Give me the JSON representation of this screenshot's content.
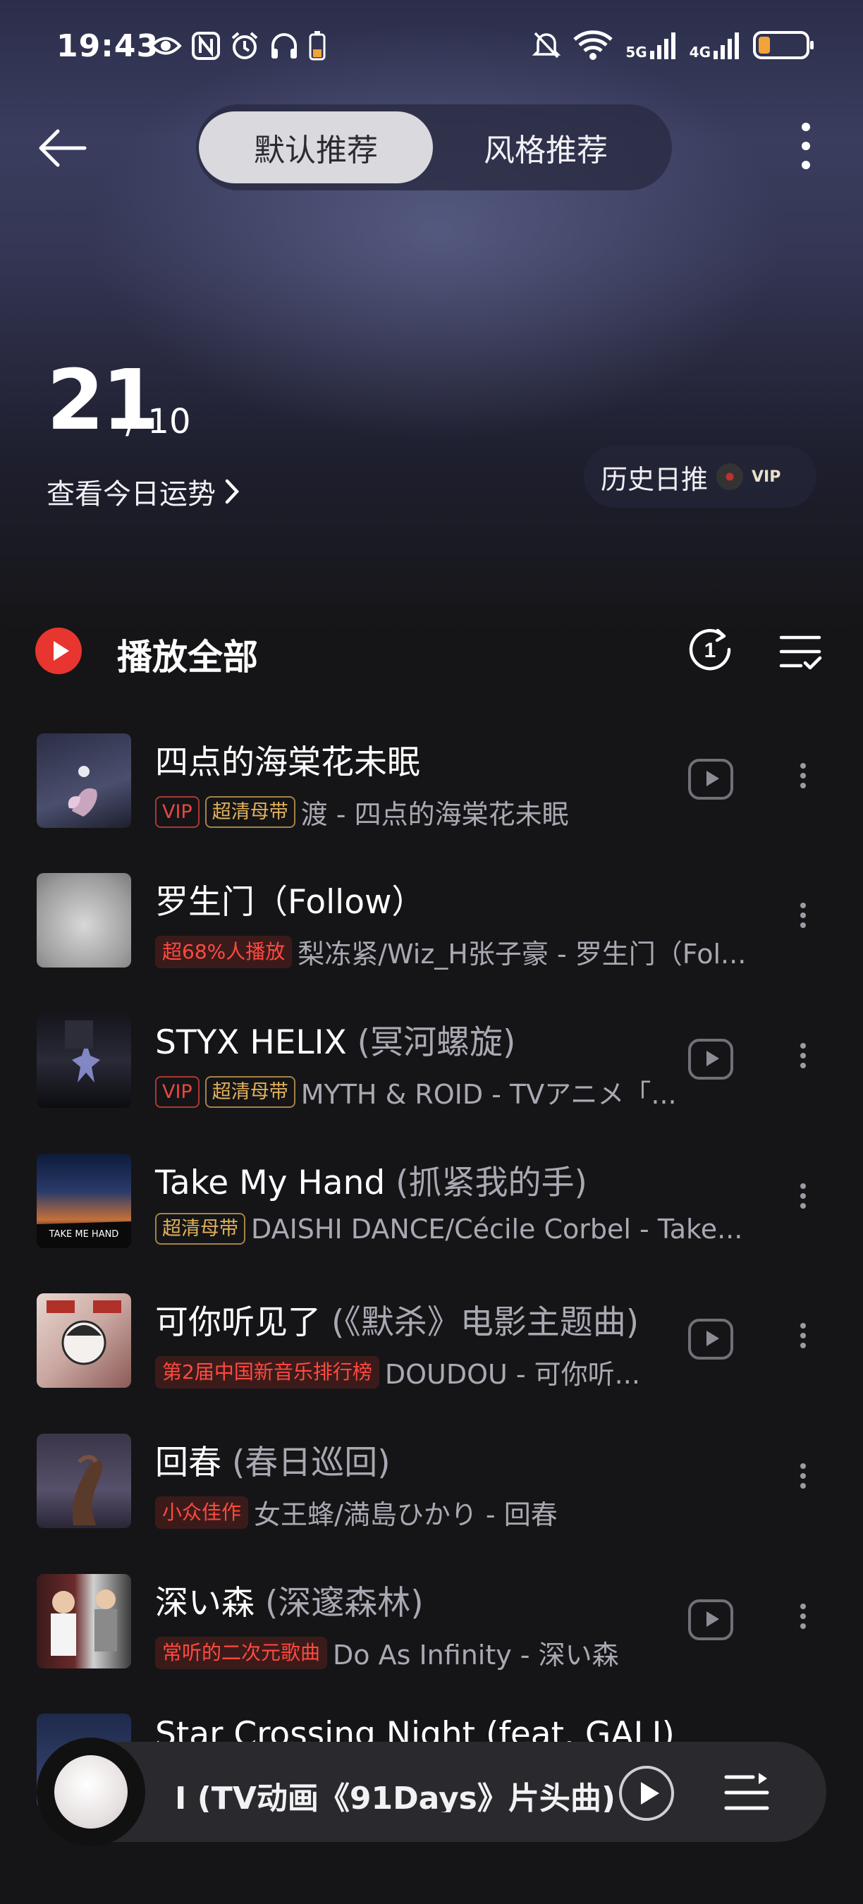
{
  "status_bar": {
    "time": "19:43",
    "net_5g": "5G",
    "net_4g": "4G",
    "battery_level": 0.25
  },
  "header": {
    "tabs": [
      {
        "label": "默认推荐",
        "active": true
      },
      {
        "label": "风格推荐",
        "active": false
      }
    ]
  },
  "date": {
    "day": "21",
    "month": "/ 10",
    "fortune_link": "查看今日运势",
    "history_label": "历史日推",
    "history_badge": "VIP"
  },
  "play_all": {
    "label": "播放全部",
    "loop_count": "1"
  },
  "songs": [
    {
      "title": "四点的海棠花未眠",
      "subtitle": "",
      "badges": [
        {
          "text": "VIP",
          "type": "vip"
        },
        {
          "text": "超清母带",
          "type": "sq"
        }
      ],
      "artist": "渡 - 四点的海棠花未眠",
      "has_play": true
    },
    {
      "title": "罗生门（Follow）",
      "subtitle": "",
      "badges": [
        {
          "text": "超68%人播放",
          "type": "red"
        }
      ],
      "artist": "梨冻紧/Wiz_H张子豪 - 罗生门（Fol...",
      "has_play": false
    },
    {
      "title": "STYX HELIX",
      "subtitle": "(冥河螺旋)",
      "badges": [
        {
          "text": "VIP",
          "type": "vip"
        },
        {
          "text": "超清母带",
          "type": "sq"
        }
      ],
      "artist": "MYTH & ROID - TVアニメ「...",
      "has_play": true
    },
    {
      "title": "Take My Hand",
      "subtitle": "(抓紧我的手)",
      "badges": [
        {
          "text": "超清母带",
          "type": "sq"
        }
      ],
      "artist": "DAISHI DANCE/Cécile Corbel - Take...",
      "has_play": false
    },
    {
      "title": "可你听见了",
      "subtitle": "(《默杀》电影主题曲)",
      "badges": [
        {
          "text": "第2届中国新音乐排行榜",
          "type": "red"
        }
      ],
      "artist": "DOUDOU - 可你听...",
      "has_play": true
    },
    {
      "title": "回春",
      "subtitle": "(春日巡回)",
      "badges": [
        {
          "text": "小众佳作",
          "type": "red"
        }
      ],
      "artist": "女王蜂/満島ひかり - 回春",
      "has_play": false
    },
    {
      "title": "深い森",
      "subtitle": "(深邃森林)",
      "badges": [
        {
          "text": "常听的二次元歌曲",
          "type": "red"
        }
      ],
      "artist": "Do As Infinity - 深い森",
      "has_play": true
    },
    {
      "title": "Star Crossing Night (feat. GALI)",
      "subtitle": "",
      "badges": [],
      "artist": "",
      "has_play": false
    }
  ],
  "mini_player": {
    "title": "I (TV动画《91Days》片头曲) - "
  }
}
